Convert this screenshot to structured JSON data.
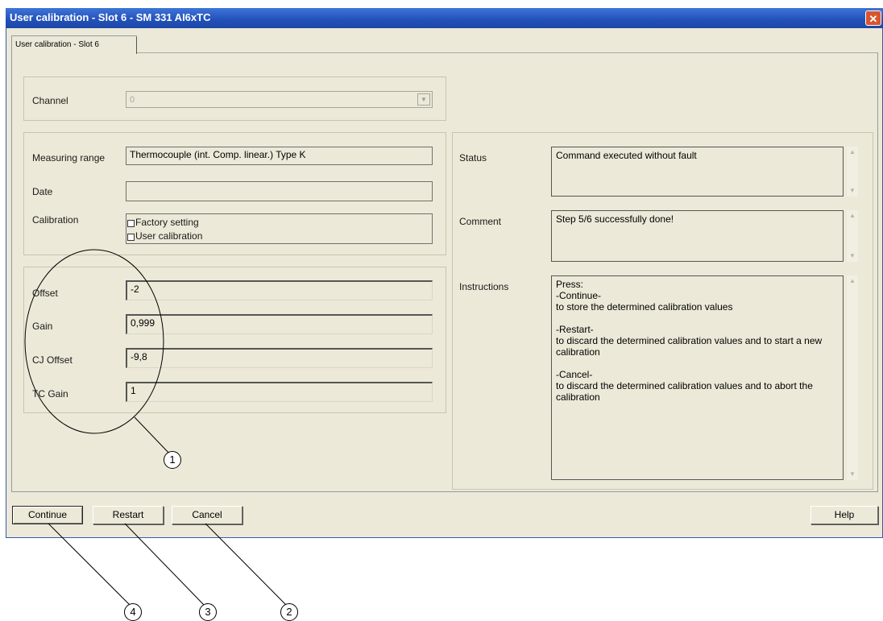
{
  "window": {
    "title": "User calibration - Slot 6 - SM 331 AI6xTC",
    "close_glyph": "✕"
  },
  "tab": {
    "label": "User calibration - Slot 6"
  },
  "channel": {
    "label": "Channel",
    "value": "0"
  },
  "measuring": {
    "range_label": "Measuring range",
    "range_value": "Thermocouple (int. Comp. linear.) Type K",
    "date_label": "Date",
    "date_value": "",
    "calibration_label": "Calibration",
    "option_factory": "Factory setting",
    "option_user": "User calibration"
  },
  "values": {
    "offset_label": "Offset",
    "offset_value": "-2",
    "gain_label": "Gain",
    "gain_value": "0,999",
    "cj_offset_label": "CJ Offset",
    "cj_offset_value": "-9,8",
    "tc_gain_label": "TC Gain",
    "tc_gain_value": "1"
  },
  "status": {
    "status_label": "Status",
    "status_text": "Command executed without fault",
    "comment_label": "Comment",
    "comment_text": "Step 5/6 successfully done!",
    "instructions_label": "Instructions",
    "instructions_text": "Press:\n-Continue-\nto store the determined calibration values\n\n-Restart-\nto discard the determined calibration values and to start a new calibration\n\n-Cancel-\nto discard the determined calibration values and to abort the calibration"
  },
  "buttons": {
    "continue": "Continue",
    "restart": "Restart",
    "cancel": "Cancel",
    "help": "Help"
  },
  "callouts": {
    "c1": "1",
    "c2": "2",
    "c3": "3",
    "c4": "4"
  },
  "colors": {
    "title_bar": "#2150b8",
    "dialog_bg": "#ece9d8",
    "close_button": "#d8552f"
  }
}
